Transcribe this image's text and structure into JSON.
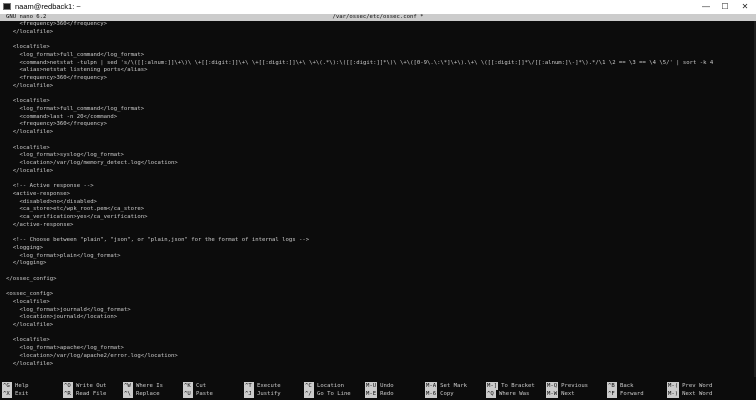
{
  "window": {
    "title": "naam@redback1: ~",
    "icon": "terminal-icon",
    "controls": [
      "—",
      "☐",
      "✕"
    ]
  },
  "nano": {
    "version": "GNU nano 6.2",
    "filename": "/var/ossec/etc/ossec.conf",
    "modified": "*"
  },
  "lines": [
    "    <frequency>360</frequency>",
    "  </localfile>",
    "",
    "  <localfile>",
    "    <log_format>full_command</log_format>",
    "    <command>netstat -tulpn | sed 's/\\([[:alnum:]]\\+\\)\\ \\+[[:digit:]]\\+\\ \\+[[:digit:]]\\+\\ \\+\\(.*\\):\\([[:digit:]]*\\)\\ \\+\\([0-9\\.\\:\\*]\\+\\).\\+\\ \\([[:digit:]]*\\/[[:alnum:]\\-]*\\).*/\\1 \\2 == \\3 == \\4 \\5/' | sort -k 4",
    "    <alias>netstat listening ports</alias>",
    "    <frequency>360</frequency>",
    "  </localfile>",
    "",
    "  <localfile>",
    "    <log_format>full_command</log_format>",
    "    <command>last -n 20</command>",
    "    <frequency>360</frequency>",
    "  </localfile>",
    "",
    "  <localfile>",
    "    <log_format>syslog</log_format>",
    "    <location>/var/log/memory_detect.log</location>",
    "  </localfile>",
    "",
    "  <!-- Active response -->",
    "  <active-response>",
    "    <disabled>no</disabled>",
    "    <ca_store>etc/wpk_root.pem</ca_store>",
    "    <ca_verification>yes</ca_verification>",
    "  </active-response>",
    "",
    "  <!-- Choose between \"plain\", \"json\", or \"plain,json\" for the format of internal logs -->",
    "  <logging>",
    "    <log_format>plain</log_format>",
    "  </logging>",
    "",
    "</ossec_config>",
    "",
    "<ossec_config>",
    "  <localfile>",
    "    <log_format>journald</log_format>",
    "    <location>journald</location>",
    "  </localfile>",
    "",
    "  <localfile>",
    "    <log_format>apache</log_format>",
    "    <location>/var/log/apache2/error.log</location>",
    "  </localfile>",
    ""
  ],
  "shortcuts": [
    {
      "key1": "^G",
      "label1": "Help",
      "key2": "^X",
      "label2": "Exit"
    },
    {
      "key1": "^O",
      "label1": "Write Out",
      "key2": "^R",
      "label2": "Read File"
    },
    {
      "key1": "^W",
      "label1": "Where Is",
      "key2": "^\\",
      "label2": "Replace"
    },
    {
      "key1": "^K",
      "label1": "Cut",
      "key2": "^U",
      "label2": "Paste"
    },
    {
      "key1": "^T",
      "label1": "Execute",
      "key2": "^J",
      "label2": "Justify"
    },
    {
      "key1": "^C",
      "label1": "Location",
      "key2": "^/",
      "label2": "Go To Line"
    },
    {
      "key1": "M-U",
      "label1": "Undo",
      "key2": "M-E",
      "label2": "Redo"
    },
    {
      "key1": "M-A",
      "label1": "Set Mark",
      "key2": "M-6",
      "label2": "Copy"
    },
    {
      "key1": "M-]",
      "label1": "To Bracket",
      "key2": "^Q",
      "label2": "Where Was"
    },
    {
      "key1": "M-Q",
      "label1": "Previous",
      "key2": "M-W",
      "label2": "Next"
    },
    {
      "key1": "^B",
      "label1": "Back",
      "key2": "^F",
      "label2": "Forward"
    },
    {
      "key1": "M-(",
      "label1": "Prev Word",
      "key2": "M-)",
      "label2": "Next Word"
    }
  ]
}
